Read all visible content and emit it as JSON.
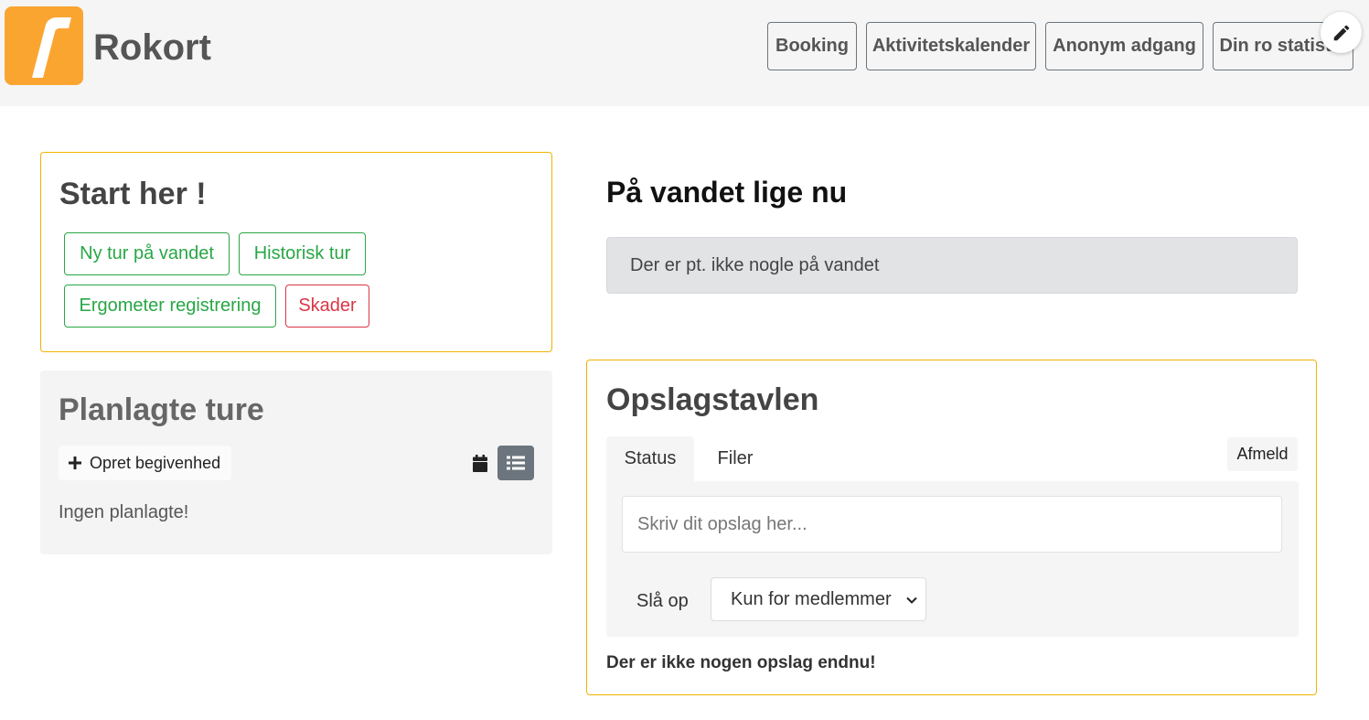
{
  "header": {
    "title": "Rokort",
    "nav": [
      "Booking",
      "Aktivitetskalender",
      "Anonym adgang",
      "Din ro statistik"
    ]
  },
  "start_card": {
    "title": "Start her !",
    "buttons": {
      "new_trip": "Ny tur på vandet",
      "historic_trip": "Historisk tur",
      "ergometer": "Ergometer registrering",
      "damages": "Skader"
    }
  },
  "planned_card": {
    "title": "Planlagte ture",
    "create_label": "Opret begivenhed",
    "empty": "Ingen planlagte!"
  },
  "on_water": {
    "title": "På vandet lige nu",
    "status": "Der er pt. ikke nogle på vandet"
  },
  "board": {
    "title": "Opslagstavlen",
    "tabs": [
      "Status",
      "Filer"
    ],
    "unsubscribe": "Afmeld",
    "post_placeholder": "Skriv dit opslag her...",
    "post_label": "Slå op",
    "audience_selected": "Kun for medlemmer",
    "empty": "Der er ikke nogen opslag endnu!"
  },
  "colors": {
    "brand": "#fba531",
    "card_border": "#f0b400",
    "success": "#28a745",
    "danger": "#dc3545",
    "secondary": "#6c757d"
  },
  "icons": [
    "rokort-logo",
    "pencil-icon",
    "plus-icon",
    "calendar-icon",
    "list-icon",
    "chevron-down-icon"
  ]
}
